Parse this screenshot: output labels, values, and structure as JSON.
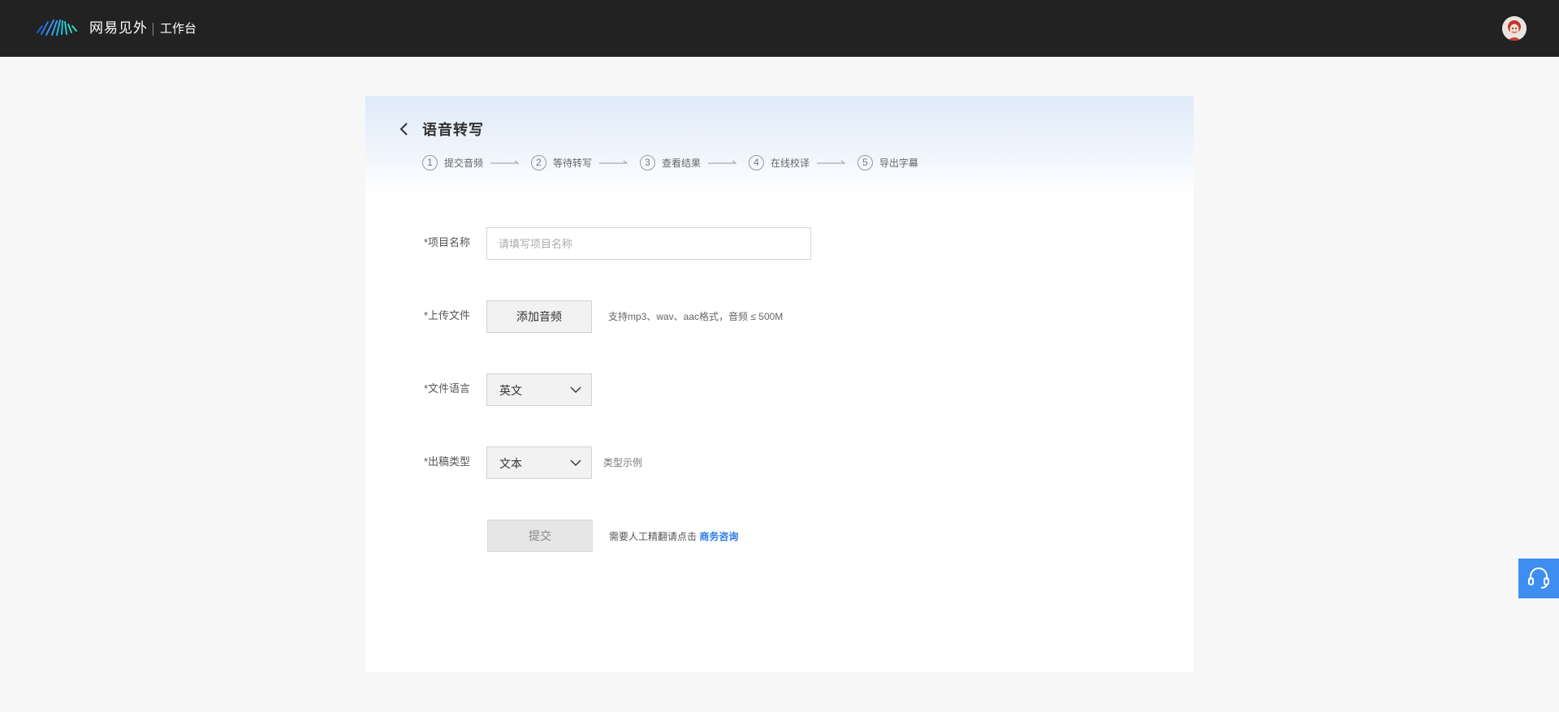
{
  "header": {
    "brand": "网易见外",
    "workspace": "工作台",
    "logo_icon": "waveform-logo-icon",
    "avatar_icon": "user-avatar-icon"
  },
  "page": {
    "title": "语音转写",
    "back_icon": "chevron-left-icon",
    "steps": [
      {
        "num": "1",
        "label": "提交音频"
      },
      {
        "num": "2",
        "label": "等待转写"
      },
      {
        "num": "3",
        "label": "查看结果"
      },
      {
        "num": "4",
        "label": "在线校译"
      },
      {
        "num": "5",
        "label": "导出字幕"
      }
    ]
  },
  "form": {
    "project_name": {
      "label": "*项目名称",
      "placeholder": "请填写项目名称",
      "value": ""
    },
    "upload": {
      "label": "*上传文件",
      "button": "添加音频",
      "hint": "支持mp3、wav、aac格式，音频 ≤ 500M"
    },
    "language": {
      "label": "*文件语言",
      "value": "英文"
    },
    "output_type": {
      "label": "*出稿类型",
      "value": "文本",
      "example_link": "类型示例"
    },
    "submit": {
      "label": "提交",
      "hint": "需要人工精翻请点击",
      "link": "商务咨询"
    }
  },
  "colors": {
    "topbar": "#222222",
    "accent": "#2c7be5",
    "support_button": "#3d8ef0"
  },
  "support_icon": "headset-icon"
}
